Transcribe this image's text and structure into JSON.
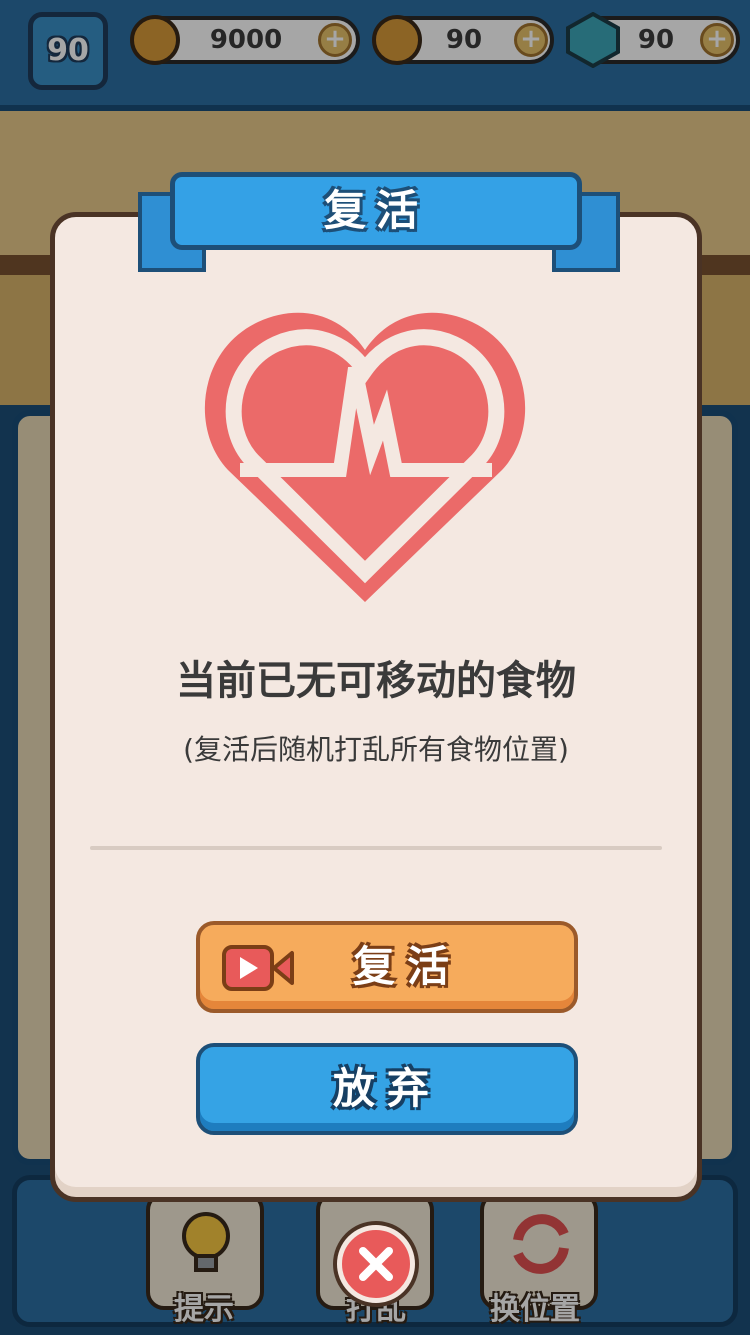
{
  "topbar": {
    "level": "90",
    "coins": "9000",
    "paw_coins": "90",
    "gems": "90"
  },
  "toolbar": {
    "hint_label": "提示",
    "shuffle_label": "打乱",
    "swap_label": "换位置"
  },
  "dialog": {
    "title": "复活",
    "headline": "当前已无可移动的食物",
    "subline": "(复活后随机打乱所有食物位置)",
    "revive_label": "复活",
    "quit_label": "放弃"
  },
  "colors": {
    "heart": "#eb6a69",
    "dialog_bg": "#f4e8e1",
    "revive_button": "#f6ab5c",
    "quit_button": "#35a3e5",
    "close_button": "#e85a5a"
  },
  "icons": [
    "video-icon",
    "heart-pulse-icon",
    "close-icon",
    "coin-icon",
    "gem-icon",
    "plus-icon",
    "lightbulb-icon"
  ]
}
